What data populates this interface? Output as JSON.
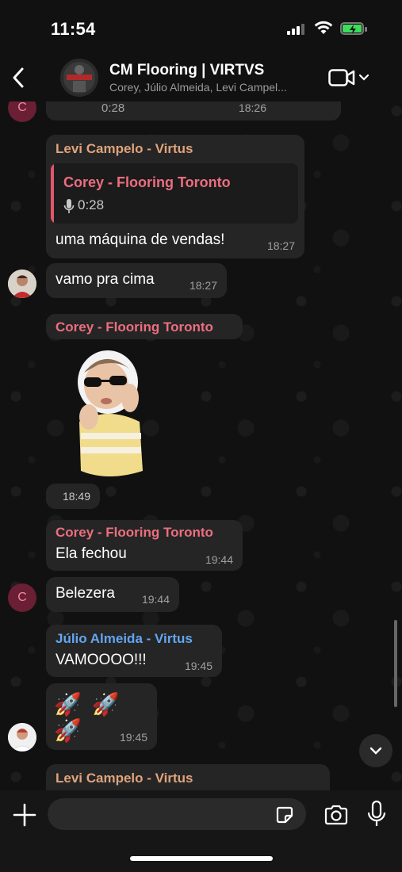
{
  "status_bar": {
    "time": "11:54"
  },
  "header": {
    "title": "CM Flooring | VIRTVS",
    "subtitle": "Corey, Júlio Almeida, Levi Campel..."
  },
  "colors": {
    "corey": "#ec6e7f",
    "levi": "#e0a37c",
    "julio": "#63a6f2",
    "bubble": "#252525"
  },
  "messages": {
    "m0": {
      "duration": "0:28",
      "time": "18:26",
      "avatar_letter": "C"
    },
    "m1": {
      "sender": "Levi Campelo - Virtus",
      "reply_sender": "Corey - Flooring Toronto",
      "reply_duration": "0:28",
      "text": "uma máquina de vendas!",
      "time": "18:27"
    },
    "m2": {
      "text": "vamo pra cima",
      "time": "18:27"
    },
    "m3": {
      "sender": "Corey - Flooring Toronto",
      "sticker": "kid-sunglasses-sticker",
      "time": "18:49"
    },
    "m4": {
      "sender": "Corey - Flooring Toronto",
      "text": "Ela fechou",
      "time": "19:44"
    },
    "m5": {
      "text": "Belezera",
      "time": "19:44",
      "avatar_letter": "C"
    },
    "m6": {
      "sender": "Júlio Almeida - Virtus",
      "text": "VAMOOOO!!!",
      "time": "19:45"
    },
    "m7": {
      "text": "🚀 🚀 🚀",
      "time": "19:45"
    },
    "m8": {
      "sender": "Levi Campelo - Virtus"
    }
  },
  "input": {
    "placeholder": ""
  }
}
